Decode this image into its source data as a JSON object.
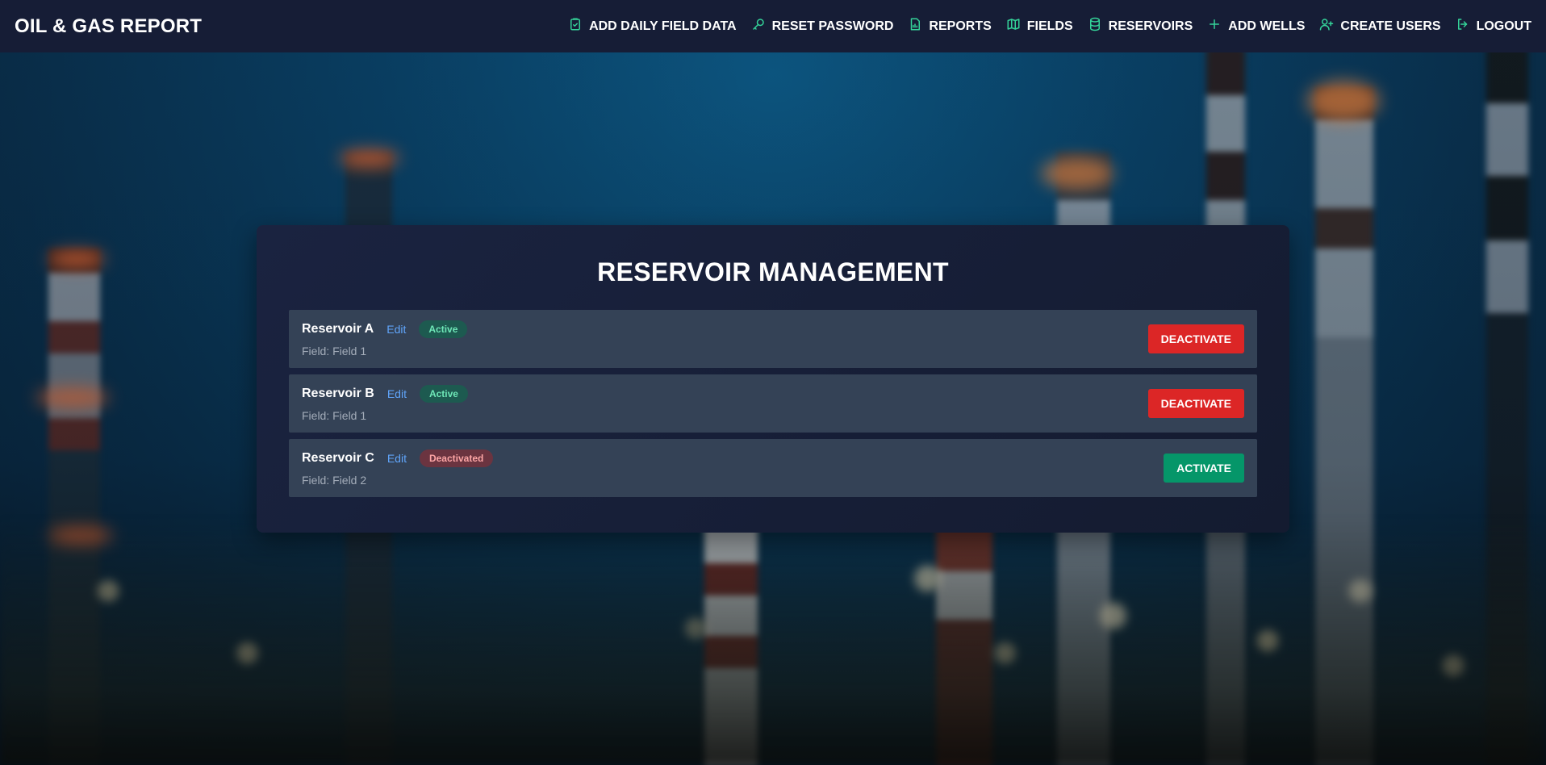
{
  "app": {
    "brand": "OIL & GAS REPORT"
  },
  "nav": {
    "items": [
      {
        "label": "ADD DAILY FIELD DATA",
        "icon": "clipboard-check-icon"
      },
      {
        "label": "RESET PASSWORD",
        "icon": "key-icon"
      },
      {
        "label": "REPORTS",
        "icon": "file-chart-icon"
      },
      {
        "label": "FIELDS",
        "icon": "map-icon"
      },
      {
        "label": "RESERVOIRS",
        "icon": "database-icon"
      },
      {
        "label": "ADD WELLS",
        "icon": "plus-icon"
      },
      {
        "label": "CREATE USERS",
        "icon": "user-plus-icon"
      },
      {
        "label": "LOGOUT",
        "icon": "logout-icon"
      }
    ],
    "icon_color": "#34d399"
  },
  "main": {
    "title": "RESERVOIR MANAGEMENT",
    "reservoirs": [
      {
        "name": "Reservoir A",
        "edit": "Edit",
        "status": "Active",
        "field": "Field: Field 1",
        "action": "DEACTIVATE"
      },
      {
        "name": "Reservoir B",
        "edit": "Edit",
        "status": "Active",
        "field": "Field: Field 1",
        "action": "DEACTIVATE"
      },
      {
        "name": "Reservoir C",
        "edit": "Edit",
        "status": "Deactivated",
        "field": "Field: Field 2",
        "action": "ACTIVATE"
      }
    ]
  },
  "colors": {
    "navbar": "#161d36",
    "card": "#1a2340",
    "row": "#344256",
    "deactivate": "#dc2626",
    "activate": "#059669",
    "link": "#60a5fa"
  }
}
